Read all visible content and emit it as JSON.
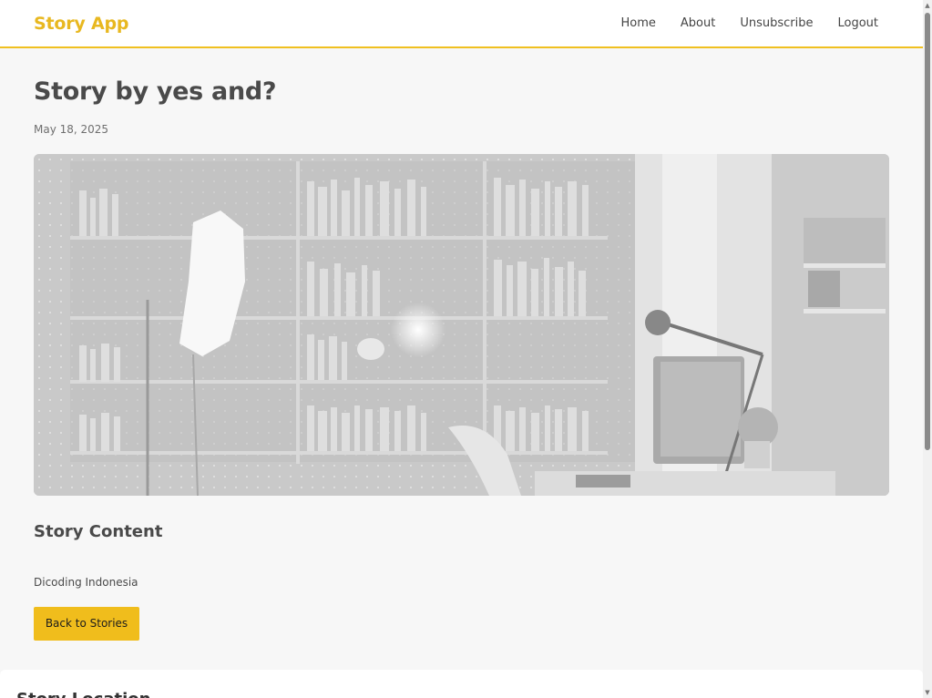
{
  "nav": {
    "brand": "Story App",
    "links": [
      {
        "label": "Home"
      },
      {
        "label": "About"
      },
      {
        "label": "Unsubscribe"
      },
      {
        "label": "Logout"
      }
    ]
  },
  "story": {
    "title": "Story by yes and?",
    "date": "May 18, 2025",
    "content_heading": "Story Content",
    "description": "Dicoding Indonesia",
    "back_button": "Back to Stories"
  },
  "location": {
    "title": "Story Location"
  },
  "colors": {
    "accent": "#f0bd1c",
    "brand": "#e8b820",
    "background": "#f7f7f7"
  }
}
